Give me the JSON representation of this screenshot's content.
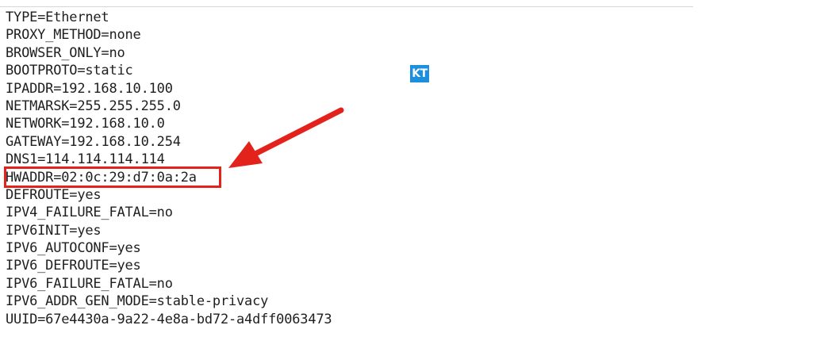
{
  "badge": {
    "text": "KT",
    "color": "#1d8fe0"
  },
  "annotation": {
    "color": "#e3231b",
    "highlight_line_index": 9
  },
  "config_lines": [
    "TYPE=Ethernet",
    "PROXY_METHOD=none",
    "BROWSER_ONLY=no",
    "BOOTPROTO=static",
    "IPADDR=192.168.10.100",
    "NETMARSK=255.255.255.0",
    "NETWORK=192.168.10.0",
    "GATEWAY=192.168.10.254",
    "DNS1=114.114.114.114",
    "HWADDR=02:0c:29:d7:0a:2a",
    "DEFROUTE=yes",
    "IPV4_FAILURE_FATAL=no",
    "IPV6INIT=yes",
    "IPV6_AUTOCONF=yes",
    "IPV6_DEFROUTE=yes",
    "IPV6_FAILURE_FATAL=no",
    "IPV6_ADDR_GEN_MODE=stable-privacy",
    "UUID=67e4430a-9a22-4e8a-bd72-a4dff0063473"
  ]
}
